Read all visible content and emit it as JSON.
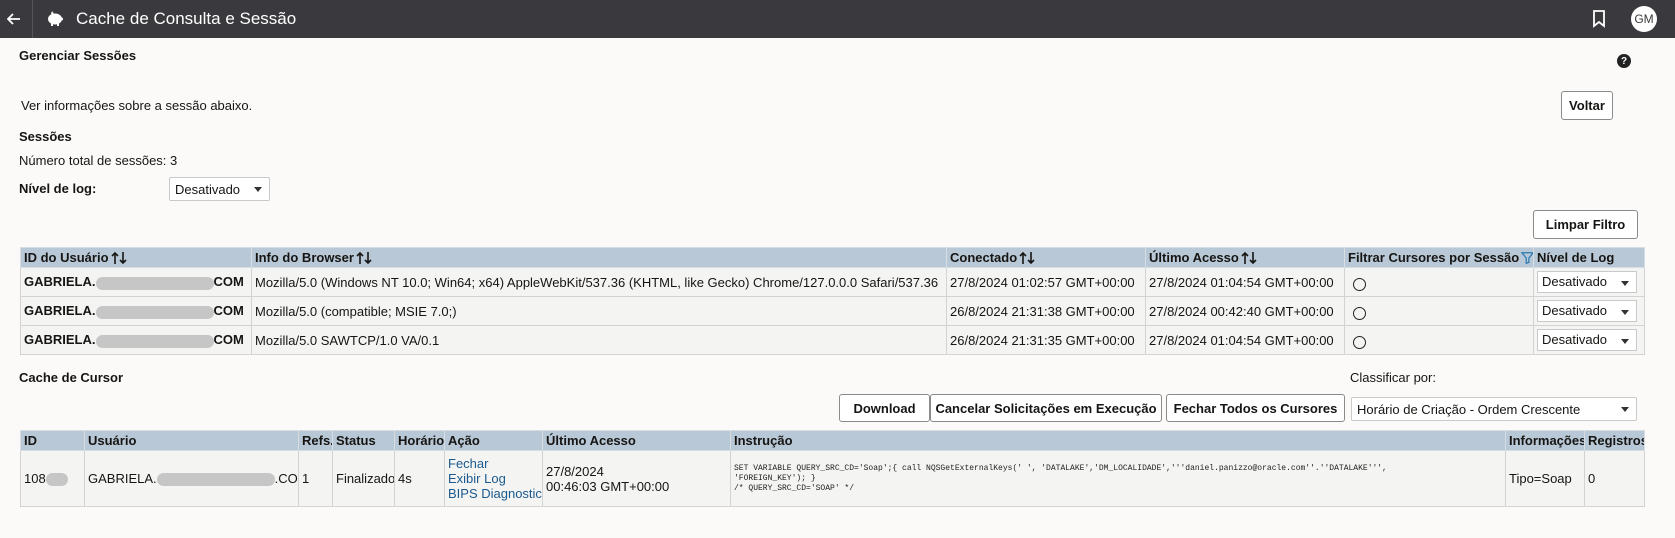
{
  "header": {
    "title": "Cache de Consulta e Sessão",
    "avatar_initials": "GM"
  },
  "page": {
    "section_title": "Gerenciar Sessões",
    "intro": "Ver informações sobre a sessão abaixo.",
    "back_button": "Voltar",
    "sessions_heading": "Sessões",
    "total_sessions": "Número total de sessões: 3",
    "log_level_label": "Nível de log:",
    "log_level_value": "Desativado",
    "clear_filter_button": "Limpar Filtro"
  },
  "sessions_table": {
    "columns": [
      "ID do Usuário",
      "Info do Browser",
      "Conectado",
      "Último Acesso",
      "Filtrar Cursores por Sessão",
      "Nível de Log"
    ],
    "rows": [
      {
        "user_prefix": "GABRIELA.",
        "user_suffix": "COM",
        "browser": "Mozilla/5.0 (Windows NT 10.0; Win64; x64) AppleWebKit/537.36 (KHTML, like Gecko) Chrome/127.0.0.0 Safari/537.36",
        "connected": "27/8/2024 01:02:57 GMT+00:00",
        "last_access": "27/8/2024 01:04:54 GMT+00:00",
        "log_level": "Desativado"
      },
      {
        "user_prefix": "GABRIELA.",
        "user_suffix": "COM",
        "browser": "Mozilla/5.0 (compatible; MSIE 7.0;)",
        "connected": "26/8/2024 21:31:38 GMT+00:00",
        "last_access": "27/8/2024 00:42:40 GMT+00:00",
        "log_level": "Desativado"
      },
      {
        "user_prefix": "GABRIELA.",
        "user_suffix": "COM",
        "browser": "Mozilla/5.0 SAWTCP/1.0 VA/0.1",
        "connected": "26/8/2024 21:31:35 GMT+00:00",
        "last_access": "27/8/2024 01:04:54 GMT+00:00",
        "log_level": "Desativado"
      }
    ]
  },
  "cursor_cache": {
    "heading": "Cache de Cursor",
    "sort_label": "Classificar por:",
    "sort_value": "Horário de Criação - Ordem Crescente",
    "download_button": "Download",
    "cancel_button": "Cancelar Solicitações em Execução",
    "close_all_button": "Fechar Todos os Cursores",
    "columns": [
      "ID",
      "Usuário",
      "Refs.",
      "Status",
      "Horário",
      "Ação",
      "Último Acesso",
      "Instrução",
      "Informações",
      "Registros"
    ],
    "rows": [
      {
        "id_prefix": "108",
        "user_prefix": "GABRIELA.",
        "user_suffix": ".COM",
        "refs": "1",
        "status": "Finalizado",
        "time": "4s",
        "actions": [
          "Fechar",
          "Exibir Log",
          "BIPS Diagnostics"
        ],
        "last_access_date": "27/8/2024",
        "last_access_time": "00:46:03 GMT+00:00",
        "instruction": "SET VARIABLE QUERY_SRC_CD='Soap';{ call NQSGetExternalKeys(' ', 'DATALAKE','DM_LOCALIDADE','''daniel.panizzo@oracle.com''.''DATALAKE''',\n'FOREIGN_KEY'); }\n/* QUERY_SRC_CD='SOAP' */",
        "info": "Tipo=Soap",
        "records": "0"
      }
    ]
  }
}
